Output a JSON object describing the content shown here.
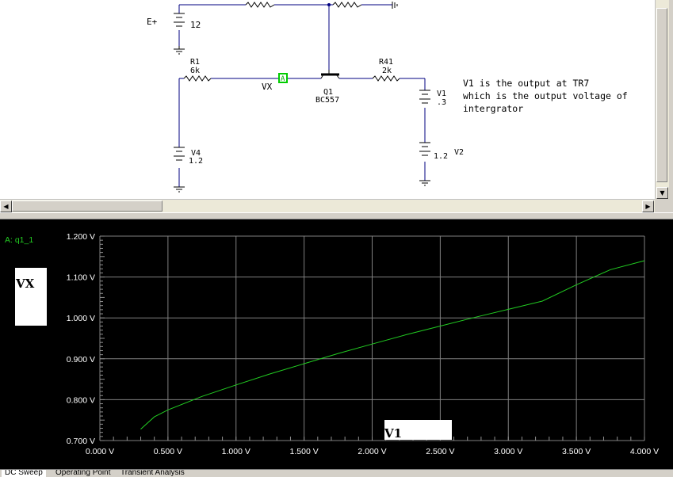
{
  "schematic": {
    "components": {
      "eplus_label": "E+",
      "eplus_value": "12",
      "r1_name": "R1",
      "r1_value": "6k",
      "r41_name": "R41",
      "r41_value": "2k",
      "q1_name": "Q1",
      "q1_model": "BC557",
      "probe_label": "A",
      "vx_label": "VX",
      "v1_name": "V1",
      "v1_value": ".3",
      "v2_name": "V2",
      "v2_value": "1.2",
      "v4_name": "V4",
      "v4_value": "1.2"
    },
    "note_lines": [
      "V1 is the output at TR7",
      "which is the output voltage of",
      "intergrator"
    ]
  },
  "plot": {
    "trace_label": "A: q1_1",
    "y_title_box": "VX",
    "x_title_box": "V1",
    "y_ticks": [
      "1.200 V",
      "1.100 V",
      "1.000 V",
      "0.900 V",
      "0.800 V",
      "0.700 V"
    ],
    "x_ticks": [
      "0.000 V",
      "0.500 V",
      "1.000 V",
      "1.500 V",
      "2.000 V",
      "2.500 V",
      "3.000 V",
      "3.500 V",
      "4.000 V"
    ],
    "colors": {
      "background": "#000000",
      "grid": "#808080",
      "trace": "#22cc22"
    }
  },
  "chart_data": {
    "type": "line",
    "title": "",
    "xlabel": "V1",
    "ylabel": "VX",
    "xlim": [
      0.0,
      4.0
    ],
    "ylim": [
      0.7,
      1.2
    ],
    "grid": true,
    "series": [
      {
        "name": "A: q1_1",
        "x": [
          0.3,
          0.4,
          0.5,
          0.75,
          1.0,
          1.25,
          1.5,
          1.75,
          2.0,
          2.25,
          2.5,
          2.75,
          3.0,
          3.25,
          3.5,
          3.75,
          4.0
        ],
        "y": [
          0.728,
          0.758,
          0.775,
          0.808,
          0.836,
          0.863,
          0.888,
          0.913,
          0.936,
          0.959,
          0.98,
          1.001,
          1.021,
          1.041,
          1.081,
          1.118,
          1.14
        ]
      }
    ]
  },
  "tabs": [
    "DC Sweep",
    "Operating Point",
    "Transient Analysis"
  ]
}
